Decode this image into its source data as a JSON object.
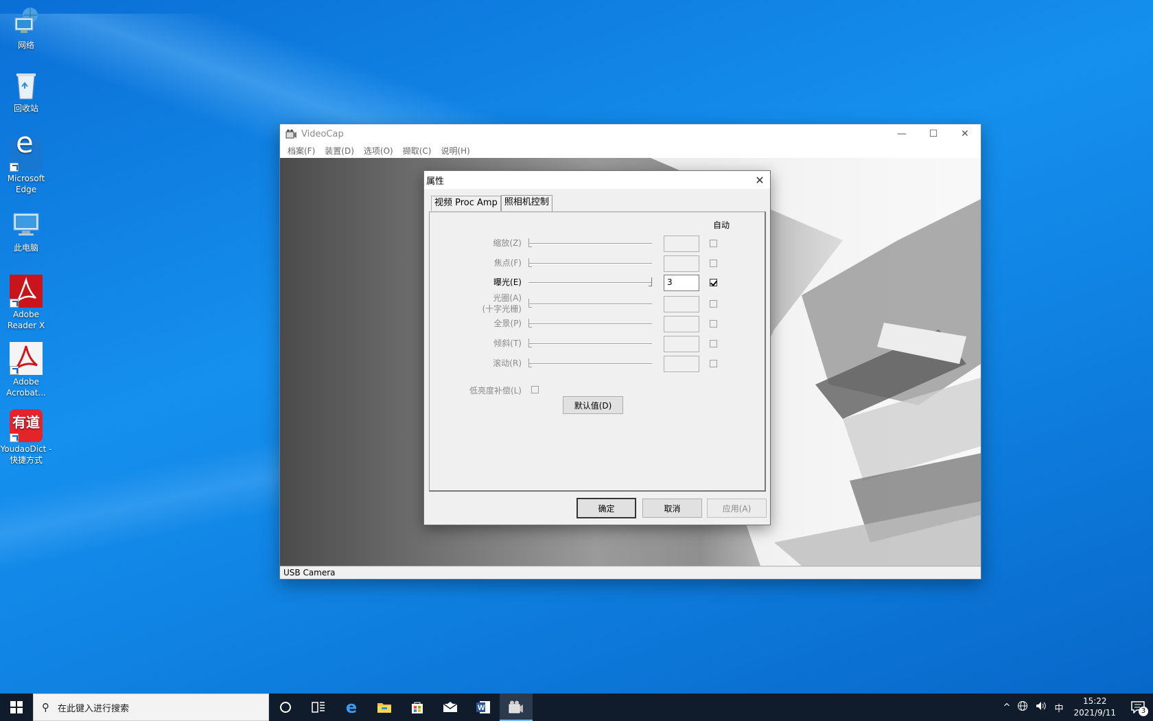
{
  "desktop": {
    "icons": [
      {
        "label": "网络",
        "icon": "network-icon"
      },
      {
        "label": "回收站",
        "icon": "recycle-bin-icon"
      },
      {
        "label": "Microsoft Edge",
        "icon": "edge-icon"
      },
      {
        "label": "此电脑",
        "icon": "this-pc-icon"
      },
      {
        "label": "Adobe Reader X",
        "icon": "adobe-reader-icon"
      },
      {
        "label": "Adobe Acrobat...",
        "icon": "adobe-acrobat-icon"
      },
      {
        "label": "YoudaoDict - 快捷方式",
        "icon": "youdao-icon"
      }
    ]
  },
  "window": {
    "title": "VideoCap",
    "controls": {
      "minimize": "—",
      "maximize": "☐",
      "close": "✕"
    },
    "menu": [
      "档案(F)",
      "装置(D)",
      "选项(O)",
      "撷取(C)",
      "说明(H)"
    ],
    "status": "USB Camera"
  },
  "dialog": {
    "title": "属性",
    "close": "✕",
    "tabs": [
      {
        "label": "视频 Proc Amp",
        "active": false
      },
      {
        "label": "照相机控制",
        "active": true
      }
    ],
    "auto_header": "自动",
    "controls": [
      {
        "label": "缩放(Z)",
        "value": "",
        "auto": false,
        "enabled": false,
        "slider_fraction": 0
      },
      {
        "label": "焦点(F)",
        "value": "",
        "auto": false,
        "enabled": false,
        "slider_fraction": 0
      },
      {
        "label": "曝光(E)",
        "value": "3",
        "auto": true,
        "enabled": true,
        "slider_fraction": 1
      },
      {
        "label": "光圈(A)",
        "label2": "(十字光栅)",
        "value": "",
        "auto": false,
        "enabled": false,
        "slider_fraction": 0
      },
      {
        "label": "全景(P)",
        "value": "",
        "auto": false,
        "enabled": false,
        "slider_fraction": 0
      },
      {
        "label": "倾斜(T)",
        "value": "",
        "auto": false,
        "enabled": false,
        "slider_fraction": 0
      },
      {
        "label": "滚动(R)",
        "value": "",
        "auto": false,
        "enabled": false,
        "slider_fraction": 0
      }
    ],
    "low_light": {
      "label": "低亮度补偿(L)",
      "checked": false
    },
    "default_button": "默认值(D)",
    "buttons": {
      "ok": "确定",
      "cancel": "取消",
      "apply": "应用(A)"
    }
  },
  "taskbar": {
    "search_placeholder": "在此键入进行搜索",
    "apps": [
      "cortana-icon",
      "task-view-icon",
      "edge-icon",
      "file-explorer-icon",
      "store-icon",
      "mail-icon",
      "word-icon",
      "videocap-icon"
    ],
    "tray": {
      "chevron": "^",
      "ime": "中",
      "time": "15:22",
      "date": "2021/9/11",
      "notifications": "3"
    }
  }
}
